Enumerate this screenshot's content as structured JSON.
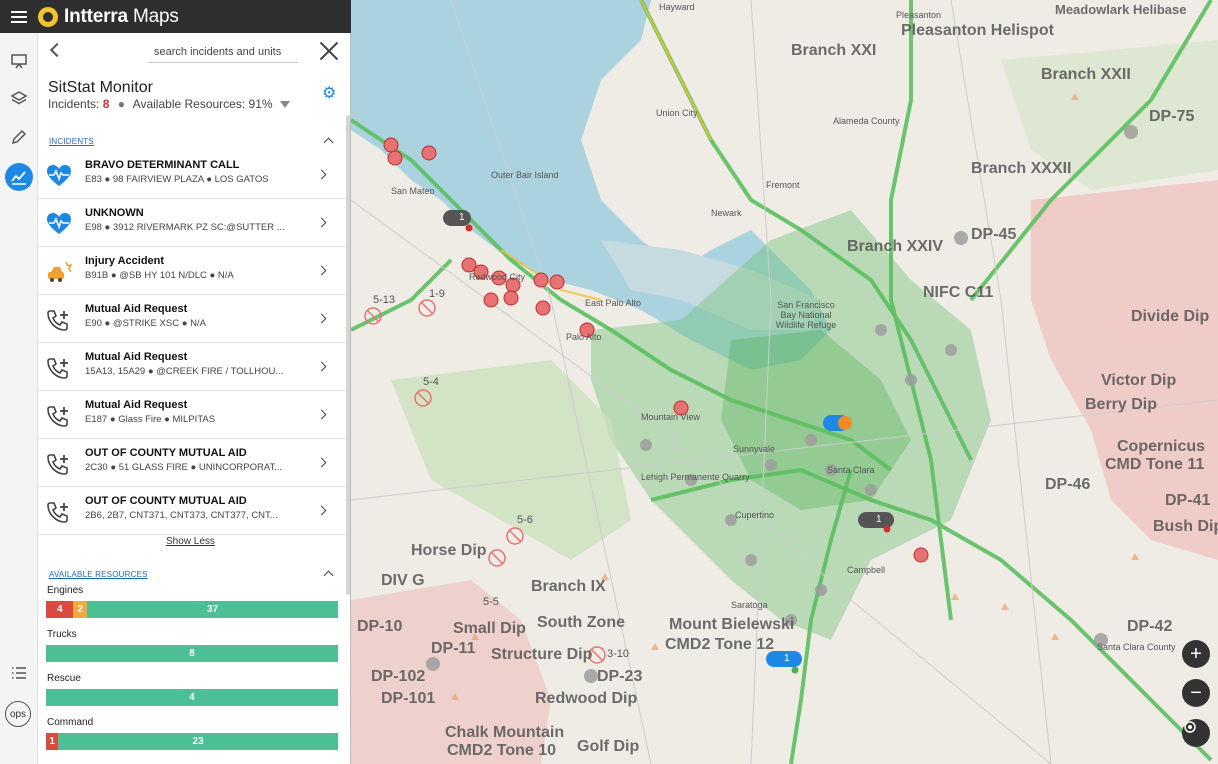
{
  "app": {
    "name_bold": "Intterra",
    "name_rest": " Maps"
  },
  "panel": {
    "search_placeholder": "search incidents and units",
    "title": "SitStat Monitor",
    "incidents_label": "Incidents:",
    "incidents_count": "8",
    "resources_label": "Available Resources:",
    "resources_pct": "91%",
    "incidents_heading": "INCIDENTS",
    "show_less": "Show Less",
    "resources_heading": "AVAILABLE RESOURCES"
  },
  "incidents": [
    {
      "name": "BRAVO DETERMINANT CALL",
      "detail": "E83 ● 98 FAIRVIEW PLAZA ● LOS GATOS",
      "icon": "heart-pulse-icon",
      "color": "#1e88e5"
    },
    {
      "name": "UNKNOWN",
      "detail": "E98 ● 3912 RIVERMARK PZ SC:@SUTTER ...",
      "icon": "heart-pulse-icon",
      "color": "#1e88e5"
    },
    {
      "name": "Injury Accident",
      "detail": "B91B ● @SB HY 101 N/DLC ● N/A",
      "icon": "car-crash-icon",
      "color": "#f0a030"
    },
    {
      "name": "Mutual Aid Request",
      "detail": "E90 ● @STRIKE XSC ● N/A",
      "icon": "phone-plus-icon",
      "color": "#444"
    },
    {
      "name": "Mutual Aid Request",
      "detail": "15A13, 15A29 ● @CREEK FIRE / TOLLHOU...",
      "icon": "phone-plus-icon",
      "color": "#444"
    },
    {
      "name": "Mutual Aid Request",
      "detail": "E187 ● Glass Fire ● MILPITAS",
      "icon": "phone-plus-icon",
      "color": "#444"
    },
    {
      "name": "OUT OF COUNTY MUTUAL AID",
      "detail": "2C30 ● 51 GLASS FIRE ● UNINCORPORAT...",
      "icon": "phone-plus-icon",
      "color": "#444"
    },
    {
      "name": "OUT OF COUNTY MUTUAL AID",
      "detail": "2B6, 2B7, CNT371, CNT373, CNT377, CNT...",
      "icon": "phone-plus-icon",
      "color": "#444"
    }
  ],
  "resources": [
    {
      "label": "Engines",
      "segments": [
        {
          "value": "4",
          "fraction": 0.094,
          "kind": "red"
        },
        {
          "value": "2",
          "fraction": 0.047,
          "kind": "orange"
        },
        {
          "value": "37",
          "fraction": 0.859,
          "kind": "green"
        }
      ]
    },
    {
      "label": "Trucks",
      "segments": [
        {
          "value": "8",
          "fraction": 1.0,
          "kind": "green"
        }
      ]
    },
    {
      "label": "Rescue",
      "segments": [
        {
          "value": "4",
          "fraction": 1.0,
          "kind": "green"
        }
      ]
    },
    {
      "label": "Command",
      "segments": [
        {
          "value": "1",
          "fraction": 0.042,
          "kind": "red"
        },
        {
          "value": "23",
          "fraction": 0.958,
          "kind": "green"
        }
      ]
    }
  ],
  "map_labels": {
    "hayward": "Hayward",
    "pleasanton": "Pleasanton",
    "pleasanton_heli": "Pleasanton Helispot",
    "meadowlark": "Meadowlark Helibase",
    "branch_xxi": "Branch XXI",
    "branch_xxii": "Branch XXII",
    "branch_xxxii": "Branch XXXII",
    "branch_xxiv": "Branch XXIV",
    "nifc": "NIFC C11",
    "fremont": "Fremont",
    "newark": "Newark",
    "union_city": "Union City",
    "san_mateo": "San Mateo",
    "redwood": "Redwood City",
    "palo_alto": "Palo Alto",
    "east_pa": "East Palo Alto",
    "mountain_view": "Mountain View",
    "sunnyvale": "Sunnyvale",
    "santa_clara": "Santa Clara",
    "cupertino": "Cupertino",
    "saratoga": "Saratoga",
    "campbell": "Campbell",
    "divide_dip": "Divide Dip",
    "victor_dip": "Victor Dip",
    "berry_dip": "Berry Dip",
    "copernicus": "Copernicus",
    "cmd_tone11": "CMD Tone 11",
    "dp46": "DP-46",
    "dp41": "DP-41",
    "bush_dip": "Bush Dip",
    "dp45": "DP-45",
    "dp75": "DP-75",
    "dp42": "DP-42",
    "horse_dip": "Horse Dip",
    "div_g": "DIV G",
    "branch_ix": "Branch IX",
    "south_zone": "South Zone",
    "small_dip": "Small Dip",
    "structure_dip": "Structure Dip",
    "mount_bielewski": "Mount Bielewski",
    "cmd2_tone12": "CMD2 Tone 12",
    "dp10": "DP-10",
    "dp11": "DP-11",
    "dp102": "DP-102",
    "dp101": "DP-101",
    "dp23": "DP-23",
    "redwood_dip": "Redwood Dip",
    "chalk": "Chalk Mountain",
    "cmd2_tone10": "CMD2 Tone 10",
    "golf_dip": "Golf Dip",
    "lehigh": "Lehigh Permanente Quarry",
    "sf_bay": "San Francisco Bay National Wildlife Refuge",
    "outer_bair": "Outer Bair Island",
    "alameda_county": "Alameda County",
    "santa_clara_county": "Santa Clara County",
    "label_513": "5-13",
    "label_19": "1-9",
    "label_54": "5-4",
    "label_56": "5-6",
    "label_55": "5-5",
    "label_310": "3-10",
    "cluster_1": "1",
    "cluster_2": "1",
    "cluster_3": "1"
  },
  "colors": {
    "accent": "#1e88e5",
    "incident_red": "#d32f2f",
    "bar_red": "#d94b3f",
    "bar_orange": "#f2a93b",
    "bar_green": "#4cbf94",
    "map_water": "#aad3df",
    "map_green": "#4caf50"
  }
}
